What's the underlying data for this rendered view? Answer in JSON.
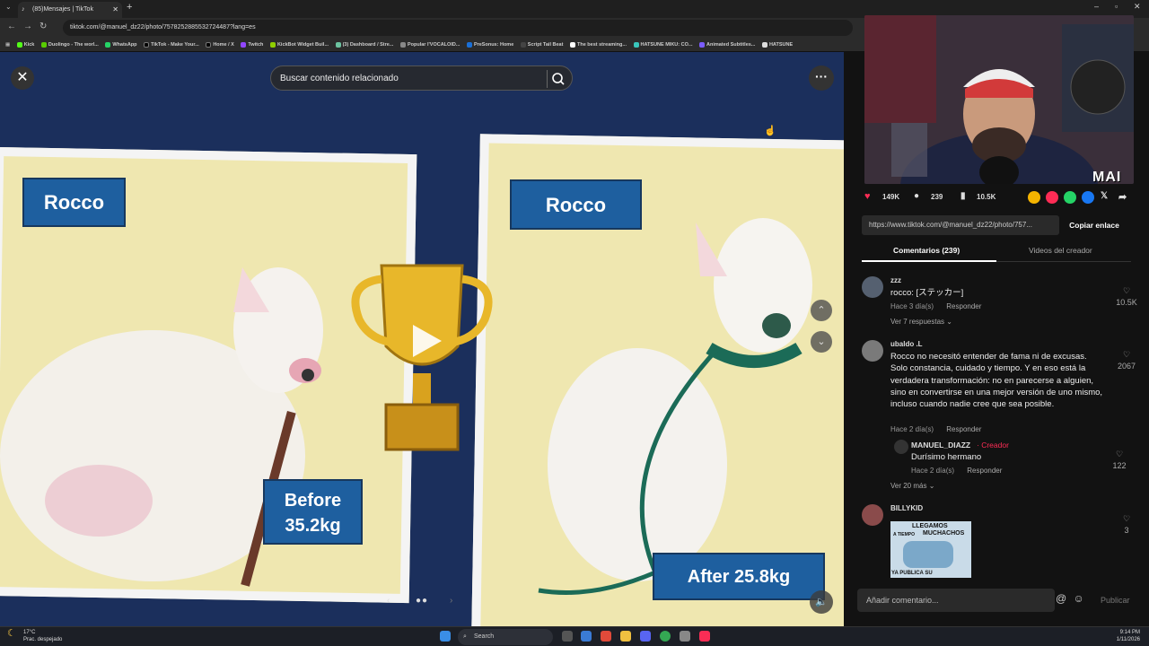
{
  "browser": {
    "tab_title": "(85)Mensajes | TikTok",
    "url": "tiktok.com/@manuel_dz22/photo/7578252885532724487?lang=es",
    "bookmarks": [
      "Kick",
      "Duolingo - The worl...",
      "WhatsApp",
      "TikTok - Make Your...",
      "Home / X",
      "Twitch",
      "KickBot Widget Buil...",
      "(3) Dashboard / Stre...",
      "Popular l'VOCALOID...",
      "PreSonus: Home",
      "Script Tail Beat",
      "The best streaming...",
      "HATSUNE MIKU: CO...",
      "Animated Subtitles...",
      "HATSUNE"
    ]
  },
  "viewer": {
    "search_placeholder": "Buscar contenido relacionado",
    "poster": {
      "name_left": "Rocco",
      "name_right": "Rocco",
      "before_line1": "Before",
      "before_line2": "35.2kg",
      "after": "After 25.8kg"
    }
  },
  "overlay": {
    "streamer_tag": "MAI"
  },
  "stats": {
    "likes": "149K",
    "comments": "239",
    "saves": "10.5K"
  },
  "share": {
    "link": "https://www.tiktok.com/@manuel_dz22/photo/757...",
    "copy_label": "Copiar enlace"
  },
  "tabs": {
    "comments": "Comentarios (239)",
    "videos": "Videos del creador"
  },
  "comments": [
    {
      "user": "zzz",
      "text": "rocco: [ステッカー]",
      "time": "Hace 3 día(s)",
      "reply": "Responder",
      "likes": "10.5K",
      "more": "Ver 7 respuestas"
    },
    {
      "user": "ubaldo .L",
      "text": "Rocco no necesitó entender de fama ni de excusas. Solo constancia, cuidado y tiempo. Y en eso está la verdadera transformación: no en parecerse a alguien, sino en convertirse en una mejor versión de uno mismo, incluso cuando nadie cree que sea posible.",
      "time": "Hace 2 día(s)",
      "reply": "Responder",
      "likes": "2067",
      "more": "Ver 20 más"
    },
    {
      "user": "BILLYKID",
      "likes": "3",
      "meme_top": "LLEGAMOS",
      "meme_left": "A TIEMPO",
      "meme_right": "MUCHACHOS",
      "meme_bottom": "YA PUBLICA SU"
    }
  ],
  "reply": {
    "user": "MANUEL_DIAZZ",
    "creator_badge": "· Creador",
    "text": "Durísimo hermano",
    "time": "Hace 2 día(s)",
    "reply": "Responder",
    "likes": "122"
  },
  "composer": {
    "placeholder": "Añadir comentario...",
    "publish": "Publicar"
  },
  "taskbar": {
    "temp": "17°C",
    "weather": "Prac. despejado",
    "search": "Search",
    "time": "9:14 PM",
    "date": "1/11/2026"
  },
  "colors": {
    "tiktok_red": "#fe2c55",
    "poster_blue": "#1e5f9f",
    "page_bg": "#121212"
  }
}
